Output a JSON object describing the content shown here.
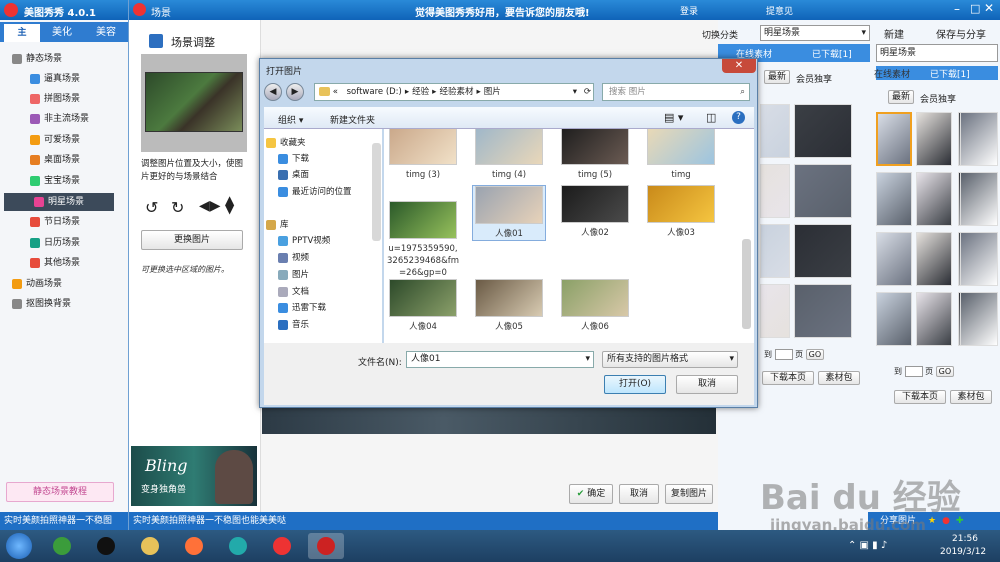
{
  "app": {
    "title": "美图秀秀 4.0.1",
    "tabs": [
      "主",
      "美化",
      "美容"
    ],
    "banner": "觉得美图秀秀好用，要告诉您的朋友哦!",
    "login": "登录",
    "feedback": "提意见",
    "new": "新建",
    "save_share": "保存与分享"
  },
  "sidebar": {
    "items": [
      "静态场景",
      "逼真场景",
      "拼图场景",
      "非主流场景",
      "可爱场景",
      "桌面场景",
      "宝宝场景",
      "明星场景",
      "节日场景",
      "日历场景",
      "其他场景",
      "动画场景",
      "抠图换背景"
    ],
    "tutorial": "静态场景教程",
    "status": "实时美颜拍照神器一不稳图"
  },
  "scene": {
    "title": "场景",
    "heading": "场景调整",
    "tip": "调整图片位置及大小，使图片更好的与场景结合",
    "replace": "更换图片",
    "handwriting": "可更换选中区域的图片。",
    "promo": "Bling",
    "promo_sub": "变身独角兽",
    "confirm": "确定",
    "cancel": "取消",
    "copy": "复制图片",
    "status": "实时美颜拍照神器一不稳图也能美美哒"
  },
  "right": {
    "switch_label": "切换分类",
    "category": "明星场景",
    "tab_online": "在线素材",
    "tab_downloaded": "已下载[1]",
    "filter_new": "最新",
    "filter_vip": "会员独享",
    "goto": "到",
    "page": "页",
    "go": "GO",
    "download_page": "下载本页",
    "pack": "素材包",
    "share": "分享图片"
  },
  "dialog": {
    "title": "打开图片",
    "path": [
      "«",
      "software (D:)",
      "经验",
      "经验素材",
      "图片"
    ],
    "search_placeholder": "搜索 图片",
    "organize": "组织 ▾",
    "new_folder": "新建文件夹",
    "nav": [
      "收藏夹",
      "下载",
      "桌面",
      "最近访问的位置",
      "库",
      "PPTV视频",
      "视频",
      "图片",
      "文档",
      "迅雷下载",
      "音乐"
    ],
    "files": [
      "timg (3)",
      "timg (4)",
      "timg (5)",
      "timg",
      "u=1975359590,3265239468&fm=26&gp=0",
      "人像01",
      "人像02",
      "人像03",
      "人像04",
      "人像05",
      "人像06"
    ],
    "filename_label": "文件名(N):",
    "filename": "人像01",
    "filter": "所有支持的图片格式",
    "open": "打开(O)",
    "cancel": "取消"
  },
  "taskbar": {
    "time": "21:56",
    "date": "2019/3/12"
  },
  "watermark": {
    "brand": "Bai du 经验",
    "url": "jingyan.baidu.com"
  }
}
